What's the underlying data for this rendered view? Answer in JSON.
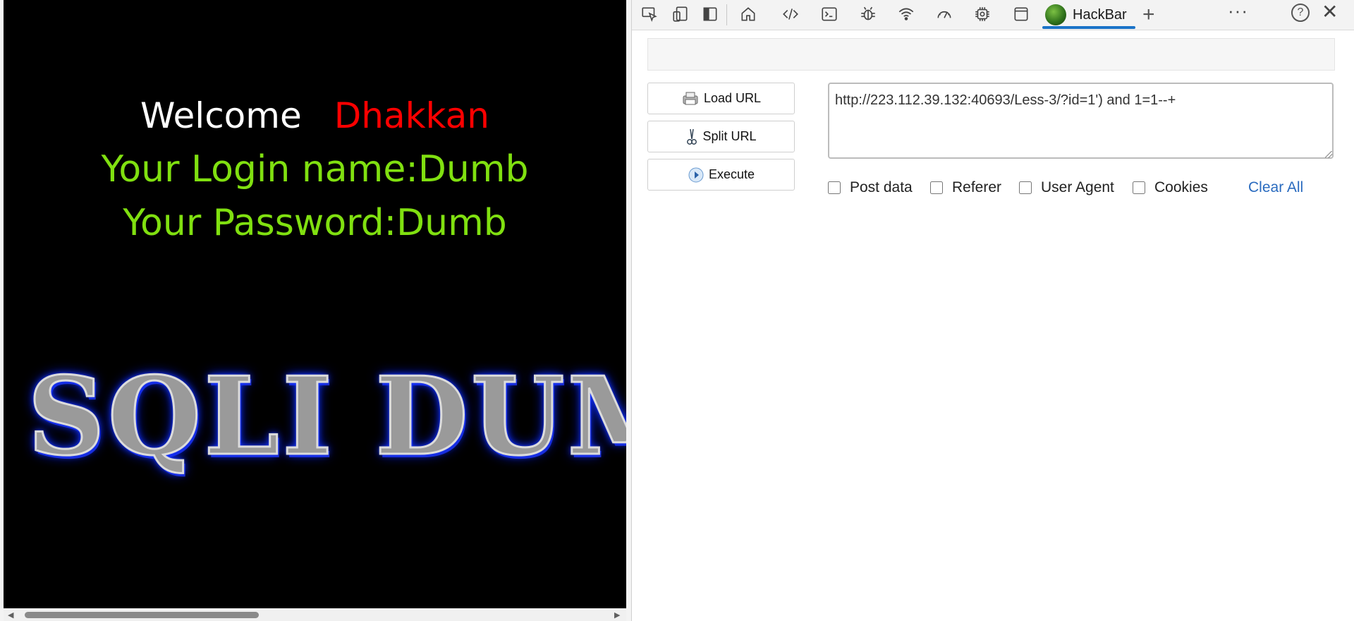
{
  "page": {
    "welcome": "Welcome",
    "name": "Dhakkan",
    "login_line": "Your Login name:Dumb",
    "password_line": "Your Password:Dumb",
    "banner_text": "SQLI DUMB",
    "colors": {
      "background": "#000000",
      "name": "#ff0000",
      "credentials": "#80e010"
    }
  },
  "devtools": {
    "toolbar_icons": [
      "inspect-icon",
      "device-emulation-icon",
      "dock-side-icon",
      "home-icon",
      "elements-icon",
      "console-icon",
      "sources-icon",
      "network-icon",
      "performance-icon",
      "memory-icon",
      "application-icon"
    ],
    "active_tab": "HackBar",
    "add_tab": "+",
    "more": "···",
    "help": "?",
    "close": "✕",
    "accent": "#1a73c8"
  },
  "hackbar": {
    "load_url": "Load URL",
    "split_url": "Split URL",
    "execute": "Execute",
    "url": "http://223.112.39.132:40693/Less-3/?id=1') and 1=1--+",
    "options": {
      "post_data": "Post data",
      "referer": "Referer",
      "user_agent": "User Agent",
      "cookies": "Cookies"
    },
    "clear_all": "Clear All"
  }
}
